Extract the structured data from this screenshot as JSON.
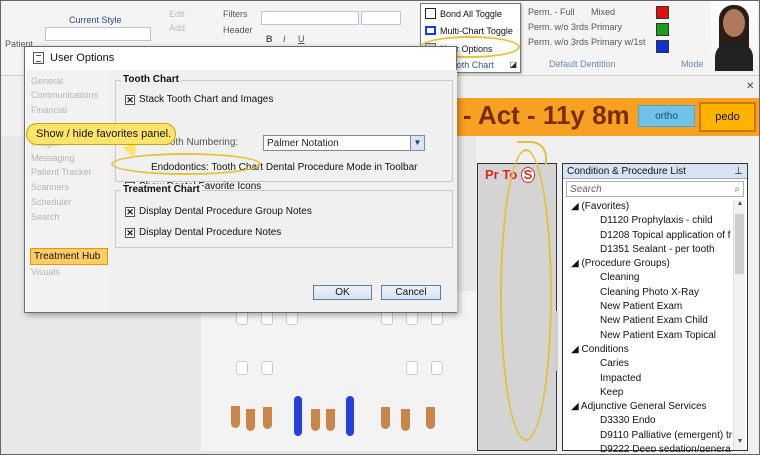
{
  "ribbon": {
    "patient_label": "Patient",
    "current_style": "Current Style",
    "edit": "Edit",
    "filters": "Filters",
    "header": "Header",
    "add": "Add",
    "defs": [
      {
        "name": "Perm. - Full",
        "value": "Mixed"
      },
      {
        "name": "Perm. w/o 3rds",
        "value": "Primary"
      },
      {
        "name": "Perm. w/o 3rds",
        "value": "Primary w/1st"
      }
    ],
    "default_dentition": "Default Dentition",
    "mode_group": "Mode",
    "tooth_chart_menu": {
      "items": [
        {
          "label": "Bond All Toggle",
          "icon": "checkbox-icon"
        },
        {
          "label": "Multi-Chart Toggle",
          "icon": "multi-chart-icon"
        },
        {
          "label": "User Options",
          "icon": "user-options-icon"
        }
      ],
      "group": "Tooth Chart"
    }
  },
  "header": {
    "age_text": "- Act - 11y 8m",
    "ortho": "ortho",
    "pedo": "pedo"
  },
  "favorites": {
    "pr": "Pr",
    "to": "To",
    "s": "S"
  },
  "condition_panel": {
    "title": "Condition & Procedure List",
    "pin": "📌",
    "search_placeholder": "Search",
    "items": [
      {
        "text": "◢ (Favorites)",
        "level": 1
      },
      {
        "text": "D1120  Prophylaxis - child",
        "level": 2
      },
      {
        "text": "D1208  Topical application of f",
        "level": 2
      },
      {
        "text": "D1351  Sealant - per tooth",
        "level": 2
      },
      {
        "text": "◢ (Procedure Groups)",
        "level": 1
      },
      {
        "text": "Cleaning",
        "level": 2
      },
      {
        "text": "Cleaning Photo X-Ray",
        "level": 2
      },
      {
        "text": "New Patient Exam",
        "level": 2
      },
      {
        "text": "New Patient Exam Child",
        "level": 2
      },
      {
        "text": "New Patient Exam Topical",
        "level": 2
      },
      {
        "text": "◢ Conditions",
        "level": 1
      },
      {
        "text": "Caries",
        "level": 2
      },
      {
        "text": "Impacted",
        "level": 2
      },
      {
        "text": "Keep",
        "level": 2
      },
      {
        "text": "◢ Adjunctive General Services",
        "level": 1
      },
      {
        "text": "D3330  Endo",
        "level": 2
      },
      {
        "text": "D9110  Palliative (emergent) tr",
        "level": 2
      },
      {
        "text": "D9222  Deep sedation/genera",
        "level": 2
      }
    ]
  },
  "dialog": {
    "title": "User Options",
    "nav": [
      "General",
      "Communications",
      "Financial",
      "Images",
      "Messaging",
      "Patient Tracker",
      "Scanners",
      "Scheduler",
      "Search",
      "Treatment Hub",
      "Visuals"
    ],
    "nav_selected": "Treatment Hub",
    "tooth_chart": {
      "title": "Tooth Chart",
      "stack": "Stack Tooth Chart and Images",
      "numbering_label": "Default Tooth Numbering:",
      "numbering_value": "Palmer Notation",
      "endo_label": "Endodontics: Tooth Chart Dental Procedure Mode in Toolbar",
      "favorites": "Show Dental Favorite Icons"
    },
    "treatment_chart": {
      "title": "Treatment Chart",
      "group_notes": "Display Dental Procedure Group Notes",
      "notes": "Display Dental Procedure Notes"
    },
    "ok": "OK",
    "cancel": "Cancel"
  },
  "callout": {
    "text": "Show / hide favorites panel."
  },
  "colors": {
    "band": "#f7a021",
    "highlight": "#e1c23a",
    "callout": "#ffe36b",
    "nav_selected": "#ffcc66"
  }
}
